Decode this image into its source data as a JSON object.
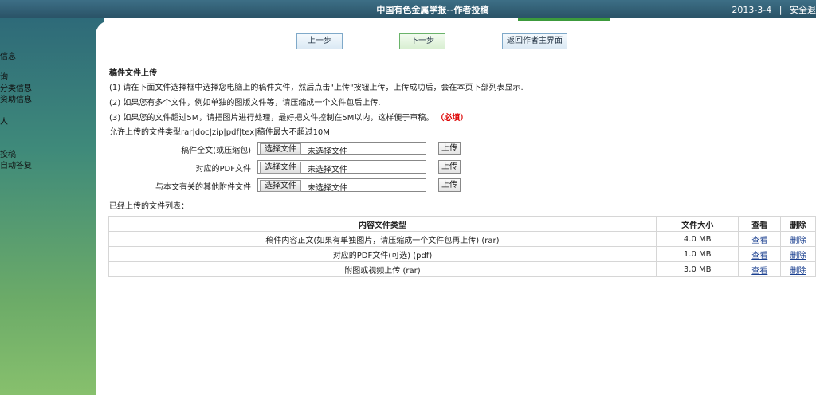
{
  "header": {
    "title": "中国有色金属学报--作者投稿",
    "date": "2013-3-4",
    "separator": "|",
    "exit_label": "安全退"
  },
  "sidebar": {
    "items": [
      "信息",
      "询",
      "分类信息",
      "资助信息",
      "人",
      "投稿",
      "自动答复"
    ]
  },
  "nav": {
    "prev": "上一步",
    "next": "下一步",
    "home": "返回作者主界面"
  },
  "upload_section": {
    "title": "稿件文件上传",
    "instructions": [
      "(1) 请在下面文件选择框中选择您电脑上的稿件文件，然后点击\"上传\"按钮上传，上传成功后，会在本页下部列表显示.",
      "(2) 如果您有多个文件，例如单独的图版文件等，请压缩成一个文件包后上传.",
      "(3) 如果您的文件超过5M，请把图片进行处理，最好把文件控制在5M以内，这样便于审稿。"
    ],
    "required_note": "（必填）",
    "allowed_types": "允许上传的文件类型rar|doc|zip|pdf|tex|稿件最大不超过10M",
    "fields": [
      {
        "label": "稿件全文(或压缩包)",
        "choose": "选择文件",
        "status": "未选择文件",
        "upload": "上传"
      },
      {
        "label": "对应的PDF文件",
        "choose": "选择文件",
        "status": "未选择文件",
        "upload": "上传"
      },
      {
        "label": "与本文有关的其他附件文件",
        "choose": "选择文件",
        "status": "未选择文件",
        "upload": "上传"
      }
    ]
  },
  "uploaded": {
    "title": "已经上传的文件列表：",
    "columns": [
      "内容文件类型",
      "文件大小",
      "查看",
      "删除"
    ],
    "rows": [
      {
        "type": "稿件内容正文(如果有单独图片，请压缩成一个文件包再上传) (rar)",
        "size": "4.0 MB",
        "view": "查看",
        "delete": "删除"
      },
      {
        "type": "对应的PDF文件(可选) (pdf)",
        "size": "1.0 MB",
        "view": "查看",
        "delete": "删除"
      },
      {
        "type": "附图或视频上传 (rar)",
        "size": "3.0 MB",
        "view": "查看",
        "delete": "删除"
      }
    ]
  },
  "colors": {
    "header_bg": "#2f5a6e",
    "required": "#dd0000",
    "link": "#1a3f8f"
  }
}
